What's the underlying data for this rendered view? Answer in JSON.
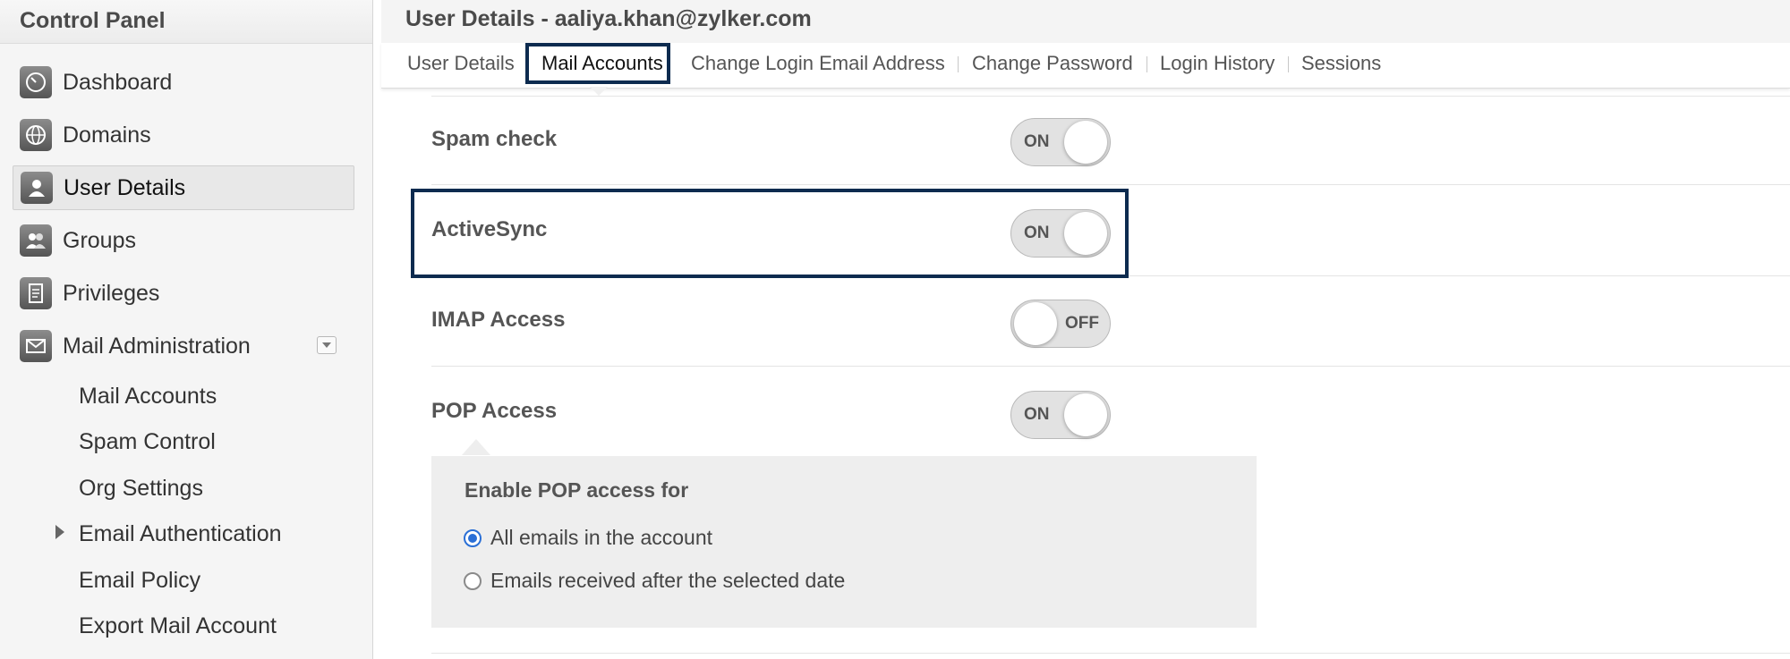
{
  "sidebar": {
    "title": "Control Panel",
    "items": [
      {
        "label": "Dashboard",
        "icon": "dashboard-icon"
      },
      {
        "label": "Domains",
        "icon": "globe-icon"
      },
      {
        "label": "User Details",
        "icon": "user-icon",
        "active": true
      },
      {
        "label": "Groups",
        "icon": "group-icon"
      },
      {
        "label": "Privileges",
        "icon": "privileges-icon"
      },
      {
        "label": "Mail Administration",
        "icon": "mail-icon"
      }
    ],
    "sub_items": [
      {
        "label": "Mail Accounts"
      },
      {
        "label": "Spam Control"
      },
      {
        "label": "Org Settings"
      },
      {
        "label": "Email Authentication",
        "expandable": true
      },
      {
        "label": "Email Policy"
      },
      {
        "label": "Export Mail Account"
      }
    ]
  },
  "main": {
    "title": "User Details - aaliya.khan@zylker.com",
    "tabs": [
      {
        "label": "User Details"
      },
      {
        "label": "Mail Accounts",
        "selected": true
      },
      {
        "label": "Change Login Email Address"
      },
      {
        "label": "Change Password"
      },
      {
        "label": "Login History"
      },
      {
        "label": "Sessions"
      }
    ],
    "settings": [
      {
        "label": "Spam check",
        "state": "ON"
      },
      {
        "label": "ActiveSync",
        "state": "ON"
      },
      {
        "label": "IMAP Access",
        "state": "OFF"
      },
      {
        "label": "POP Access",
        "state": "ON"
      }
    ],
    "pop_panel": {
      "title": "Enable POP access for",
      "options": [
        {
          "label": "All emails in the account",
          "checked": true
        },
        {
          "label": "Emails received after the selected date",
          "checked": false
        }
      ]
    }
  },
  "colors": {
    "highlight_border": "#0d2b4f",
    "radio_selected": "#2a6fd6"
  }
}
